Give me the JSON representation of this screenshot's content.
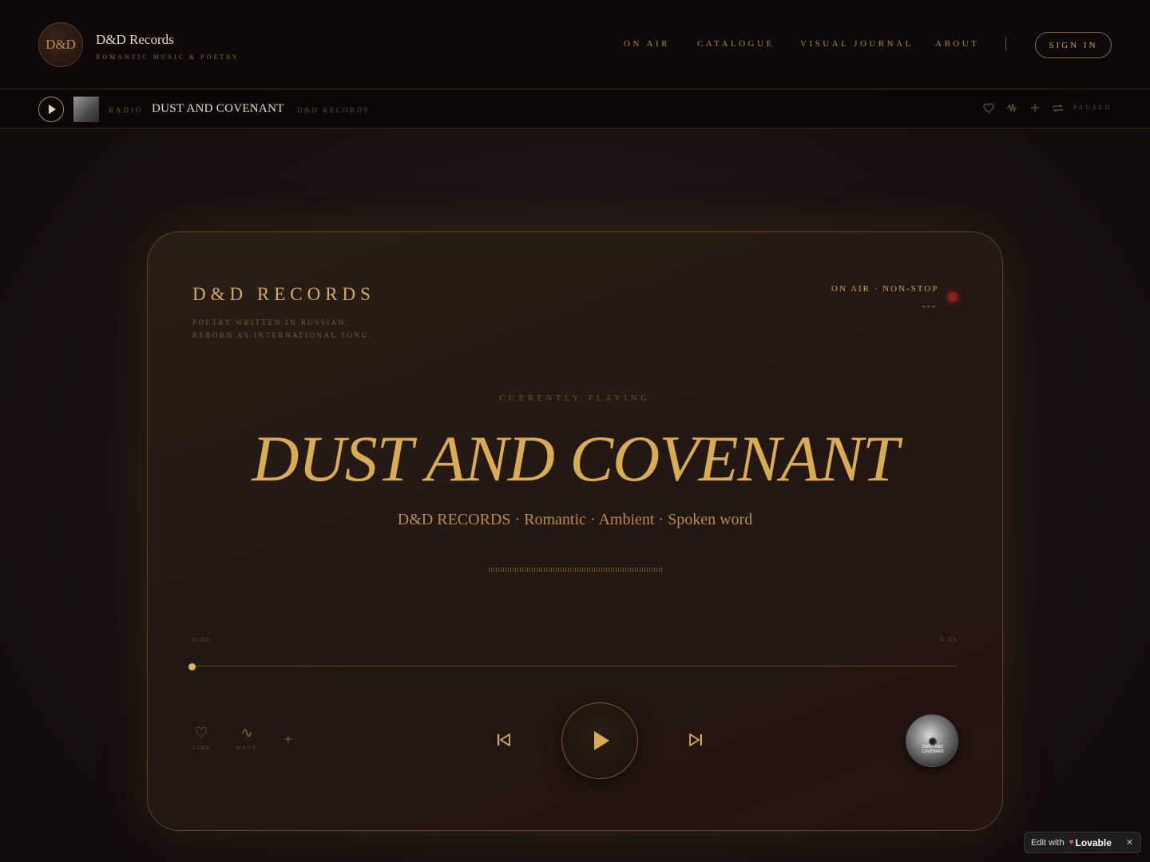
{
  "header": {
    "logo_text": "D&D",
    "brand_name": "D&D Records",
    "brand_sub": "ROMANTIC MUSIC & POETRY",
    "nav": [
      "ON AIR",
      "CATALOGUE",
      "VISUAL JOURNAL",
      "ABOUT"
    ],
    "signin_label": "SIGN IN"
  },
  "minibar": {
    "radio_label": "RADIO",
    "track_title": "DUST AND COVENANT",
    "artist_label": "D&D RECORDS",
    "status": "PAUSED",
    "icons": [
      "heart-icon",
      "wave-icon",
      "plus-icon",
      "repeat-icon"
    ]
  },
  "card": {
    "brand": "D&D RECORDS",
    "sub_line_1": "POETRY WRITTEN IN RUSSIAN,",
    "sub_line_2": "REBORN AS INTERNATIONAL SONG.",
    "on_air": "ON AIR · NON-STOP",
    "on_air_dashes": "---",
    "now_label": "CURRENTLY PLAYING",
    "title": "DUST AND COVENANT",
    "meta": "D&D RECORDS · Romantic · Ambient · Spoken word",
    "time_start": "0:00",
    "time_end": "3:55",
    "progress": 0.0,
    "actions": {
      "like_label": "LIKE",
      "wave_label": "WAVE"
    },
    "disc_text": "DUST AND COVENANT"
  },
  "badge": {
    "edit_with": "Edit with",
    "brand": "Lovable"
  },
  "colors": {
    "accent": "#d9ac54",
    "background": "#1c1412",
    "live_dot": "#8e1c1c"
  }
}
